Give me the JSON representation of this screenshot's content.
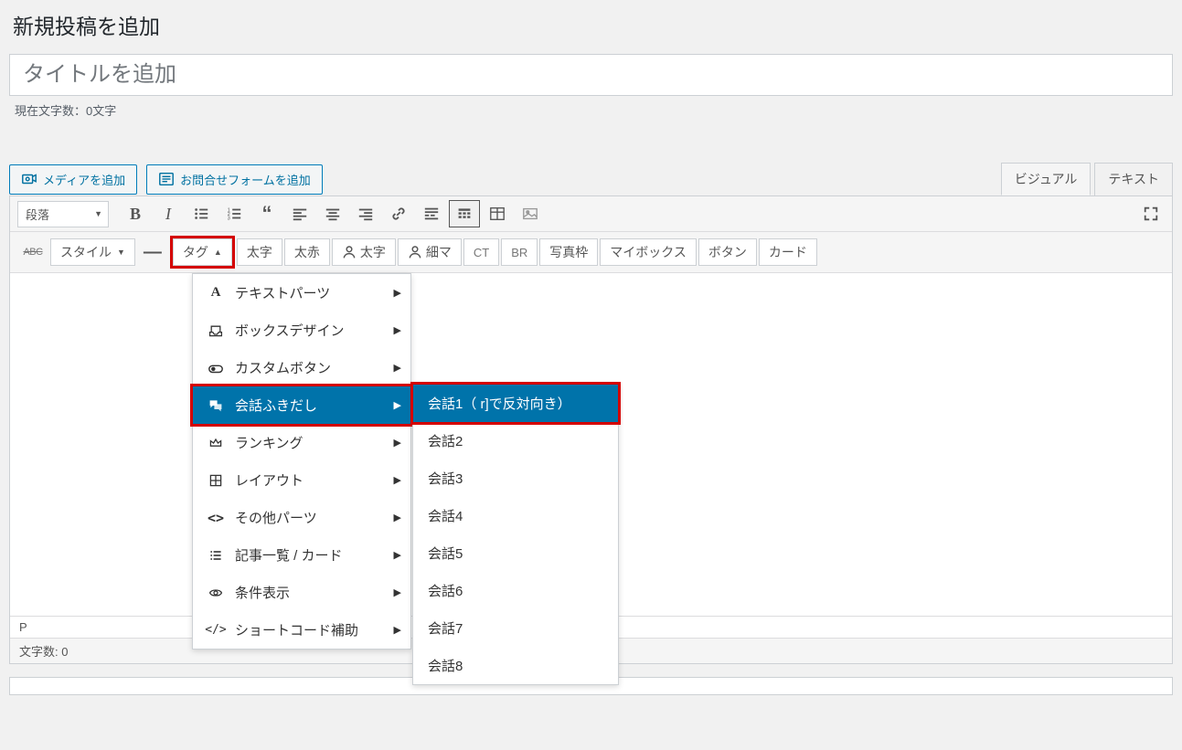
{
  "page": {
    "title": "新規投稿を追加",
    "title_placeholder": "タイトルを追加",
    "char_count_label": "現在文字数：0文字"
  },
  "buttons": {
    "add_media": "メディアを追加",
    "add_contact_form": "お問合せフォームを追加"
  },
  "tabs": {
    "visual": "ビジュアル",
    "text": "テキスト"
  },
  "toolbar": {
    "format_select": "段落",
    "style_select": "スタイル",
    "tag_dropdown": "タグ",
    "btn_bold_big": "太字",
    "btn_bold_red": "太赤",
    "btn_person_bold": "太字",
    "btn_person_thin": "細マ",
    "btn_ct": "CT",
    "btn_br": "BR",
    "btn_photo_frame": "写真枠",
    "btn_mybox": "マイボックス",
    "btn_button": "ボタン",
    "btn_card": "カード"
  },
  "dropdown": {
    "items": [
      {
        "icon": "A",
        "label": "テキストパーツ"
      },
      {
        "icon": "inbox",
        "label": "ボックスデザイン"
      },
      {
        "icon": "toggle",
        "label": "カスタムボタン"
      },
      {
        "icon": "chat",
        "label": "会話ふきだし",
        "selected": true
      },
      {
        "icon": "crown",
        "label": "ランキング"
      },
      {
        "icon": "grid",
        "label": "レイアウト"
      },
      {
        "icon": "code",
        "label": "その他パーツ"
      },
      {
        "icon": "list",
        "label": "記事一覧 / カード"
      },
      {
        "icon": "eye",
        "label": "条件表示"
      },
      {
        "icon": "brackets",
        "label": "ショートコード補助"
      }
    ],
    "submenu": [
      {
        "label": "会話1（ r]で反対向き）",
        "selected": true
      },
      {
        "label": "会話2"
      },
      {
        "label": "会話3"
      },
      {
        "label": "会話4"
      },
      {
        "label": "会話5"
      },
      {
        "label": "会話6"
      },
      {
        "label": "会話7"
      },
      {
        "label": "会話8"
      }
    ]
  },
  "status": {
    "path": "P",
    "char_count": "文字数: 0"
  }
}
